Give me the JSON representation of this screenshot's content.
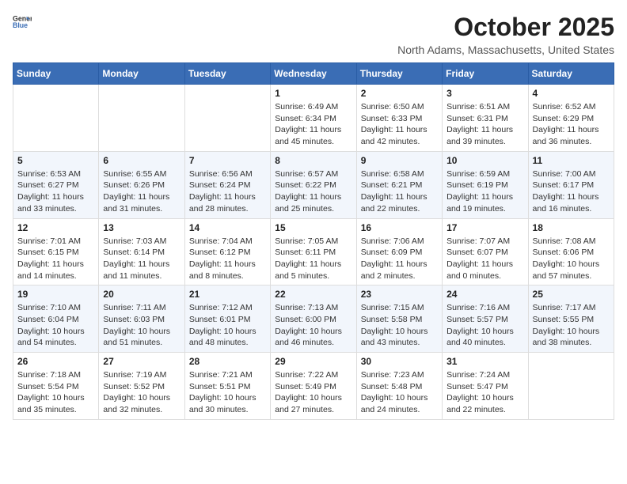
{
  "header": {
    "logo_general": "General",
    "logo_blue": "Blue",
    "month": "October 2025",
    "location": "North Adams, Massachusetts, United States"
  },
  "weekdays": [
    "Sunday",
    "Monday",
    "Tuesday",
    "Wednesday",
    "Thursday",
    "Friday",
    "Saturday"
  ],
  "weeks": [
    [
      {
        "day": "",
        "content": ""
      },
      {
        "day": "",
        "content": ""
      },
      {
        "day": "",
        "content": ""
      },
      {
        "day": "1",
        "content": "Sunrise: 6:49 AM\nSunset: 6:34 PM\nDaylight: 11 hours and 45 minutes."
      },
      {
        "day": "2",
        "content": "Sunrise: 6:50 AM\nSunset: 6:33 PM\nDaylight: 11 hours and 42 minutes."
      },
      {
        "day": "3",
        "content": "Sunrise: 6:51 AM\nSunset: 6:31 PM\nDaylight: 11 hours and 39 minutes."
      },
      {
        "day": "4",
        "content": "Sunrise: 6:52 AM\nSunset: 6:29 PM\nDaylight: 11 hours and 36 minutes."
      }
    ],
    [
      {
        "day": "5",
        "content": "Sunrise: 6:53 AM\nSunset: 6:27 PM\nDaylight: 11 hours and 33 minutes."
      },
      {
        "day": "6",
        "content": "Sunrise: 6:55 AM\nSunset: 6:26 PM\nDaylight: 11 hours and 31 minutes."
      },
      {
        "day": "7",
        "content": "Sunrise: 6:56 AM\nSunset: 6:24 PM\nDaylight: 11 hours and 28 minutes."
      },
      {
        "day": "8",
        "content": "Sunrise: 6:57 AM\nSunset: 6:22 PM\nDaylight: 11 hours and 25 minutes."
      },
      {
        "day": "9",
        "content": "Sunrise: 6:58 AM\nSunset: 6:21 PM\nDaylight: 11 hours and 22 minutes."
      },
      {
        "day": "10",
        "content": "Sunrise: 6:59 AM\nSunset: 6:19 PM\nDaylight: 11 hours and 19 minutes."
      },
      {
        "day": "11",
        "content": "Sunrise: 7:00 AM\nSunset: 6:17 PM\nDaylight: 11 hours and 16 minutes."
      }
    ],
    [
      {
        "day": "12",
        "content": "Sunrise: 7:01 AM\nSunset: 6:15 PM\nDaylight: 11 hours and 14 minutes."
      },
      {
        "day": "13",
        "content": "Sunrise: 7:03 AM\nSunset: 6:14 PM\nDaylight: 11 hours and 11 minutes."
      },
      {
        "day": "14",
        "content": "Sunrise: 7:04 AM\nSunset: 6:12 PM\nDaylight: 11 hours and 8 minutes."
      },
      {
        "day": "15",
        "content": "Sunrise: 7:05 AM\nSunset: 6:11 PM\nDaylight: 11 hours and 5 minutes."
      },
      {
        "day": "16",
        "content": "Sunrise: 7:06 AM\nSunset: 6:09 PM\nDaylight: 11 hours and 2 minutes."
      },
      {
        "day": "17",
        "content": "Sunrise: 7:07 AM\nSunset: 6:07 PM\nDaylight: 11 hours and 0 minutes."
      },
      {
        "day": "18",
        "content": "Sunrise: 7:08 AM\nSunset: 6:06 PM\nDaylight: 10 hours and 57 minutes."
      }
    ],
    [
      {
        "day": "19",
        "content": "Sunrise: 7:10 AM\nSunset: 6:04 PM\nDaylight: 10 hours and 54 minutes."
      },
      {
        "day": "20",
        "content": "Sunrise: 7:11 AM\nSunset: 6:03 PM\nDaylight: 10 hours and 51 minutes."
      },
      {
        "day": "21",
        "content": "Sunrise: 7:12 AM\nSunset: 6:01 PM\nDaylight: 10 hours and 48 minutes."
      },
      {
        "day": "22",
        "content": "Sunrise: 7:13 AM\nSunset: 6:00 PM\nDaylight: 10 hours and 46 minutes."
      },
      {
        "day": "23",
        "content": "Sunrise: 7:15 AM\nSunset: 5:58 PM\nDaylight: 10 hours and 43 minutes."
      },
      {
        "day": "24",
        "content": "Sunrise: 7:16 AM\nSunset: 5:57 PM\nDaylight: 10 hours and 40 minutes."
      },
      {
        "day": "25",
        "content": "Sunrise: 7:17 AM\nSunset: 5:55 PM\nDaylight: 10 hours and 38 minutes."
      }
    ],
    [
      {
        "day": "26",
        "content": "Sunrise: 7:18 AM\nSunset: 5:54 PM\nDaylight: 10 hours and 35 minutes."
      },
      {
        "day": "27",
        "content": "Sunrise: 7:19 AM\nSunset: 5:52 PM\nDaylight: 10 hours and 32 minutes."
      },
      {
        "day": "28",
        "content": "Sunrise: 7:21 AM\nSunset: 5:51 PM\nDaylight: 10 hours and 30 minutes."
      },
      {
        "day": "29",
        "content": "Sunrise: 7:22 AM\nSunset: 5:49 PM\nDaylight: 10 hours and 27 minutes."
      },
      {
        "day": "30",
        "content": "Sunrise: 7:23 AM\nSunset: 5:48 PM\nDaylight: 10 hours and 24 minutes."
      },
      {
        "day": "31",
        "content": "Sunrise: 7:24 AM\nSunset: 5:47 PM\nDaylight: 10 hours and 22 minutes."
      },
      {
        "day": "",
        "content": ""
      }
    ]
  ]
}
